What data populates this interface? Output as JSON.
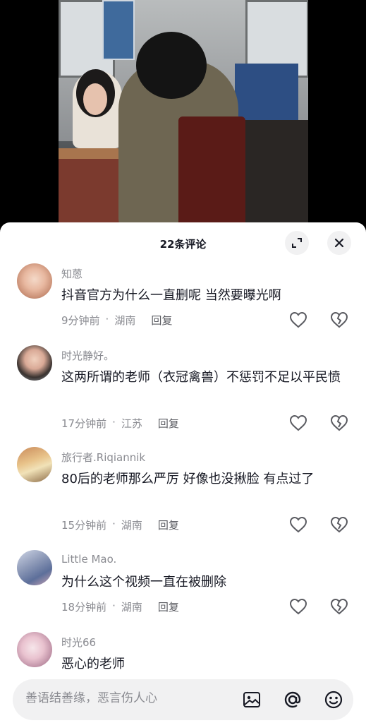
{
  "header": {
    "title": "22条评论"
  },
  "comments": [
    {
      "name": "知蒽",
      "text": "抖音官方为什么一直删呢  当然要曝光啊",
      "time": "9分钟前",
      "location": "湖南",
      "reply": "回复"
    },
    {
      "name": "时光静好。",
      "text": "这两所谓的老师（衣冠禽兽）不惩罚不足以平民愤",
      "time": "17分钟前",
      "location": "江苏",
      "reply": "回复"
    },
    {
      "name": "旅行者.Riqiannik",
      "text": "80后的老师那么严厉 好像也没揪脸 有点过了",
      "time": "15分钟前",
      "location": "湖南",
      "reply": "回复"
    },
    {
      "name": "Little Mao.",
      "text": "为什么这个视频一直在被删除",
      "time": "18分钟前",
      "location": "湖南",
      "reply": "回复"
    },
    {
      "name": "时光66",
      "text": "恶心的老师"
    }
  ],
  "input": {
    "placeholder": "善语结善缘，恶言伤人心"
  },
  "icons": {
    "expand": "expand-icon",
    "close": "close-icon",
    "like": "heart-icon",
    "dislike": "broken-heart-icon",
    "image": "image-icon",
    "mention": "at-icon",
    "emoji": "emoji-icon"
  }
}
